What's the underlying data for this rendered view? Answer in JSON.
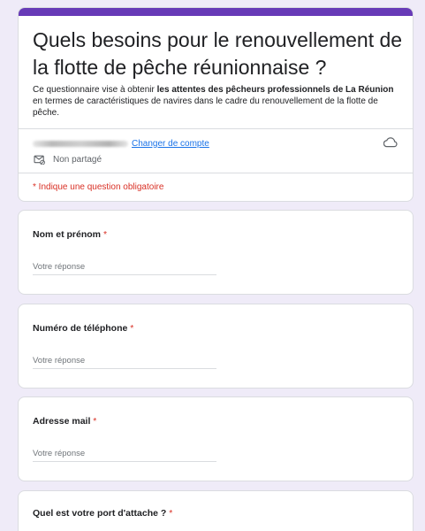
{
  "form": {
    "title": "Quels besoins pour le renouvellement de la flotte de pêche réunionnaise ?",
    "description_prefix": "Ce questionnaire vise à obtenir ",
    "description_bold": "les attentes des pêcheurs professionnels de La Réunion",
    "description_suffix": " en termes de caractéristiques de navires dans le cadre du renouvellement de la flotte de pêche.",
    "switch_account": "Changer de compte",
    "not_shared": "Non partagé",
    "required_note": "* Indique une question obligatoire",
    "accent_color": "#673ab7",
    "background_color": "#efebf8"
  },
  "icons": {
    "cloud": "cloud-save-icon",
    "share": "not-shared-icon"
  },
  "questions": [
    {
      "label": "Nom et prénom",
      "required_mark": "*",
      "placeholder": "Votre réponse"
    },
    {
      "label": "Numéro de téléphone",
      "required_mark": "*",
      "placeholder": "Votre réponse"
    },
    {
      "label": "Adresse mail",
      "required_mark": "*",
      "placeholder": "Votre réponse"
    },
    {
      "label": "Quel est votre port d'attache ?",
      "required_mark": "*"
    }
  ]
}
